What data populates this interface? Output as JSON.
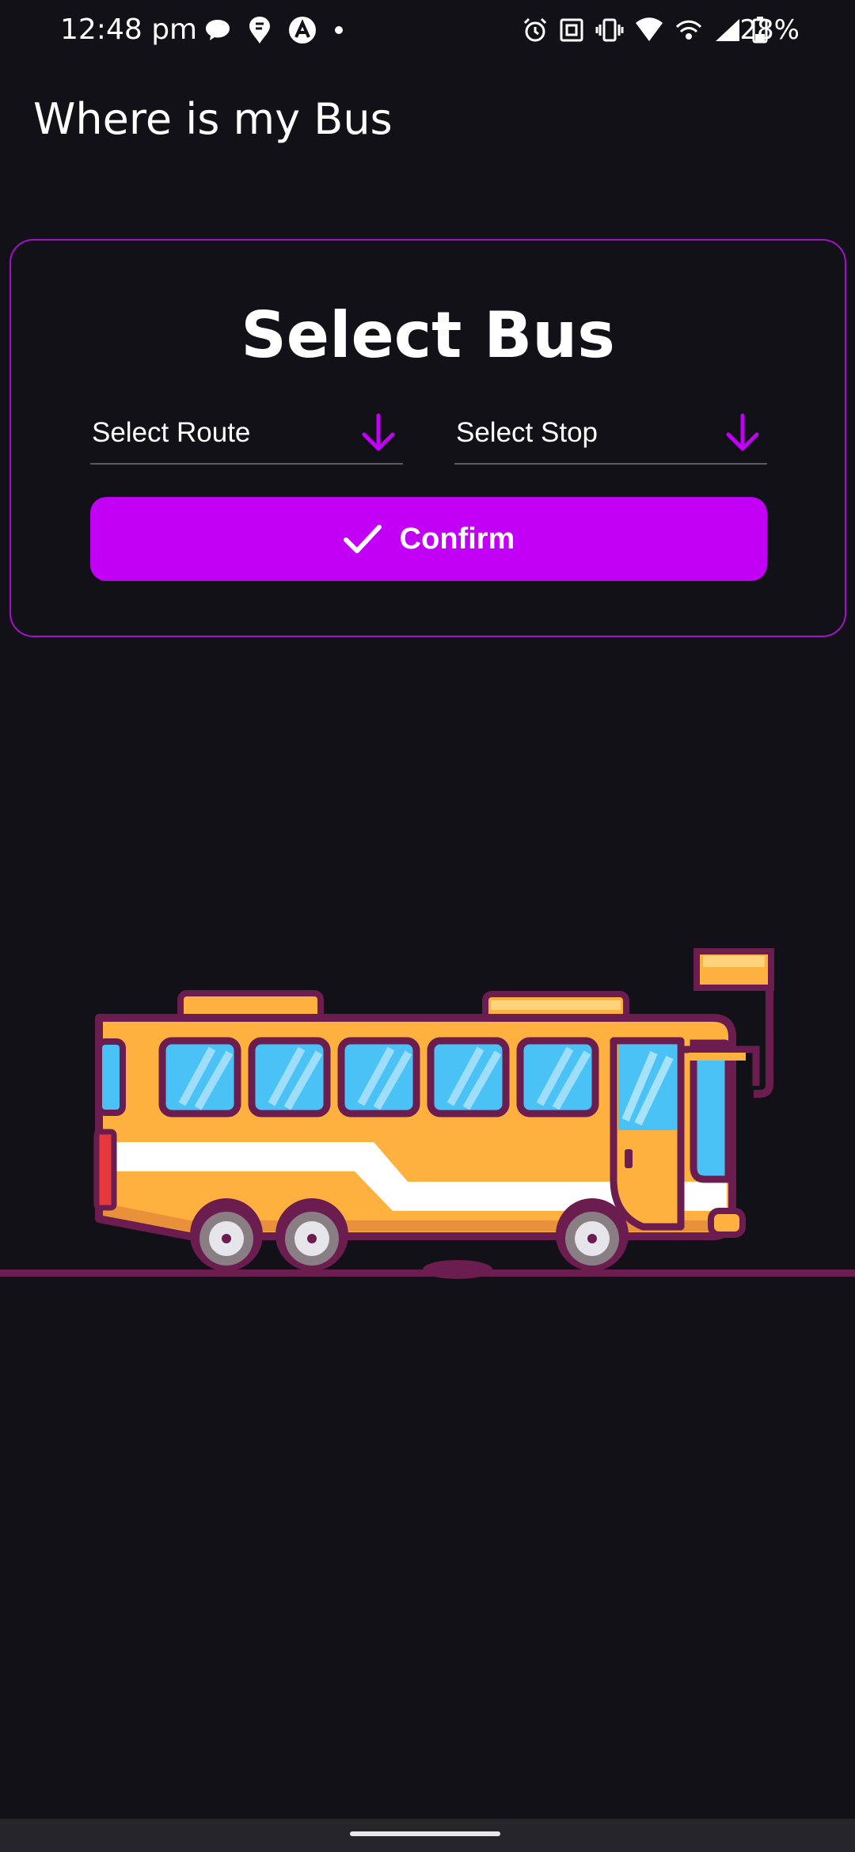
{
  "status_bar": {
    "time": "12:48 pm",
    "battery_percent": "28%",
    "left_icons": [
      "chat-bubble-icon",
      "swiggy-icon",
      "arc-app-icon",
      "more-dot-icon"
    ],
    "right_icons": [
      "alarm-icon",
      "nfc-icon",
      "vibrate-icon",
      "wifi-icon",
      "hotspot-icon",
      "signal-icon",
      "battery-icon"
    ]
  },
  "app": {
    "title": "Where is my Bus"
  },
  "card": {
    "title": "Select Bus",
    "route_dropdown": {
      "label": "Select Route",
      "icon": "arrow-down-icon"
    },
    "stop_dropdown": {
      "label": "Select Stop",
      "icon": "arrow-down-icon"
    },
    "confirm_button": {
      "label": "Confirm",
      "icon": "check-icon"
    }
  },
  "illustration": {
    "name": "bus-illustration"
  },
  "colors": {
    "background": "#131118",
    "accent": "#c100f5",
    "card_border": "#a310c9",
    "bus_body": "#feb13e",
    "bus_outline": "#6c1d4f",
    "bus_window": "#4bc2f5"
  }
}
